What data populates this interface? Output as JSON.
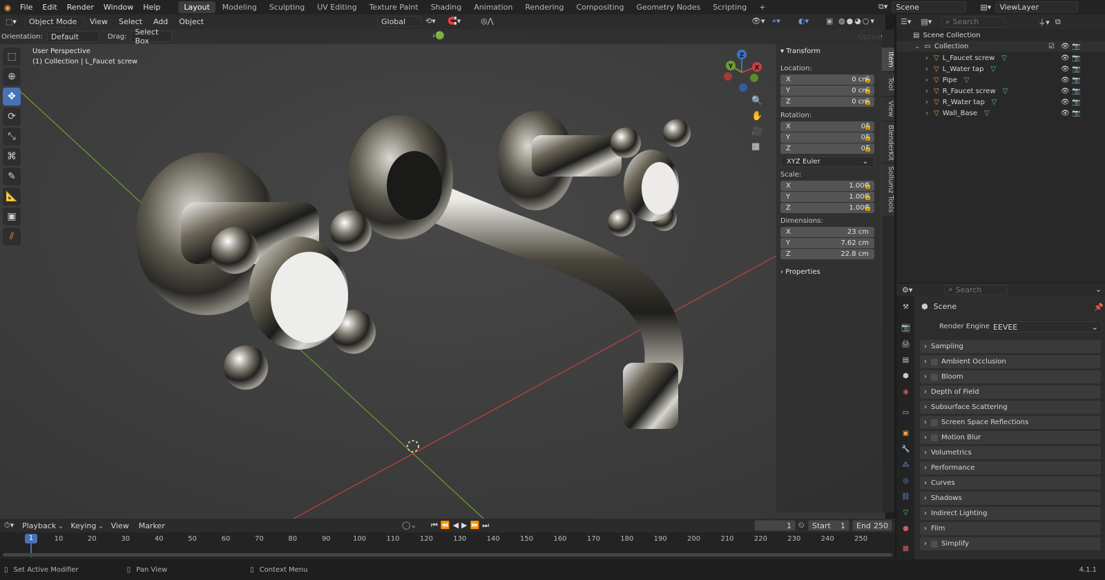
{
  "topbar": {
    "menus": [
      "File",
      "Edit",
      "Render",
      "Window",
      "Help"
    ],
    "workspaces": [
      "Layout",
      "Modeling",
      "Sculpting",
      "UV Editing",
      "Texture Paint",
      "Shading",
      "Animation",
      "Rendering",
      "Compositing",
      "Geometry Nodes",
      "Scripting"
    ],
    "active_workspace": "Layout",
    "add_tab": "+",
    "scene": "Scene",
    "view_layer": "ViewLayer"
  },
  "viewport": {
    "mode": "Object Mode",
    "menus": [
      "View",
      "Select",
      "Add",
      "Object"
    ],
    "transform_orientation": "Global",
    "orientation_label": "Orientation:",
    "orientation_value": "Default",
    "drag_label": "Drag:",
    "drag_value": "Select Box",
    "options_label": "Options",
    "perspective_text": "User Perspective",
    "collection_text": "(1) Collection | L_Faucet screw",
    "gizmo": {
      "x": "X",
      "y": "Y",
      "z": "Z"
    },
    "axis_colors": {
      "x": "#c8403f",
      "y": "#6e9e2e",
      "z": "#3a74c9"
    }
  },
  "n_panel": {
    "header": "Transform",
    "location_label": "Location:",
    "location": [
      {
        "axis": "X",
        "value": "0 cm"
      },
      {
        "axis": "Y",
        "value": "0 cm"
      },
      {
        "axis": "Z",
        "value": "0 cm"
      }
    ],
    "rotation_label": "Rotation:",
    "rotation": [
      {
        "axis": "X",
        "value": "0°"
      },
      {
        "axis": "Y",
        "value": "0°"
      },
      {
        "axis": "Z",
        "value": "0°"
      }
    ],
    "rotation_mode": "XYZ Euler",
    "scale_label": "Scale:",
    "scale": [
      {
        "axis": "X",
        "value": "1.000"
      },
      {
        "axis": "Y",
        "value": "1.000"
      },
      {
        "axis": "Z",
        "value": "1.000"
      }
    ],
    "dimensions_label": "Dimensions:",
    "dimensions": [
      {
        "axis": "X",
        "value": "23 cm"
      },
      {
        "axis": "Y",
        "value": "7.62 cm"
      },
      {
        "axis": "Z",
        "value": "22.8 cm"
      }
    ],
    "properties_label": "Properties",
    "tabs": [
      "Item",
      "Tool",
      "View",
      "BlenderKit",
      "Sollumz Tools"
    ]
  },
  "outliner": {
    "search_placeholder": "Search",
    "scene_collection": "Scene Collection",
    "collection": "Collection",
    "items": [
      "L_Faucet screw",
      "L_Water tap",
      "Pipe",
      "R_Faucet screw",
      "R_Water tap",
      "Wall_Base"
    ]
  },
  "properties": {
    "search_placeholder": "Search",
    "scene_label": "Scene",
    "render_engine_label": "Render Engine",
    "render_engine_value": "EEVEE",
    "sections": [
      {
        "label": "Sampling",
        "checkbox": false
      },
      {
        "label": "Ambient Occlusion",
        "checkbox": true
      },
      {
        "label": "Bloom",
        "checkbox": true
      },
      {
        "label": "Depth of Field",
        "checkbox": false
      },
      {
        "label": "Subsurface Scattering",
        "checkbox": false
      },
      {
        "label": "Screen Space Reflections",
        "checkbox": true
      },
      {
        "label": "Motion Blur",
        "checkbox": true
      },
      {
        "label": "Volumetrics",
        "checkbox": false
      },
      {
        "label": "Performance",
        "checkbox": false
      },
      {
        "label": "Curves",
        "checkbox": false
      },
      {
        "label": "Shadows",
        "checkbox": false
      },
      {
        "label": "Indirect Lighting",
        "checkbox": false
      },
      {
        "label": "Film",
        "checkbox": false
      },
      {
        "label": "Simplify",
        "checkbox": true
      }
    ]
  },
  "timeline": {
    "menus": [
      "Playback",
      "Keying",
      "View",
      "Marker"
    ],
    "current_frame": "1",
    "start_label": "Start",
    "start_value": "1",
    "end_label": "End",
    "end_value": "250",
    "ticks": [
      "1",
      "10",
      "20",
      "30",
      "40",
      "50",
      "60",
      "70",
      "80",
      "90",
      "100",
      "110",
      "120",
      "130",
      "140",
      "150",
      "160",
      "170",
      "180",
      "190",
      "200",
      "210",
      "220",
      "230",
      "240",
      "250"
    ]
  },
  "status": {
    "left": "Set Active Modifier",
    "middle": "Pan View",
    "right": "Context Menu",
    "version": "4.1.1"
  }
}
